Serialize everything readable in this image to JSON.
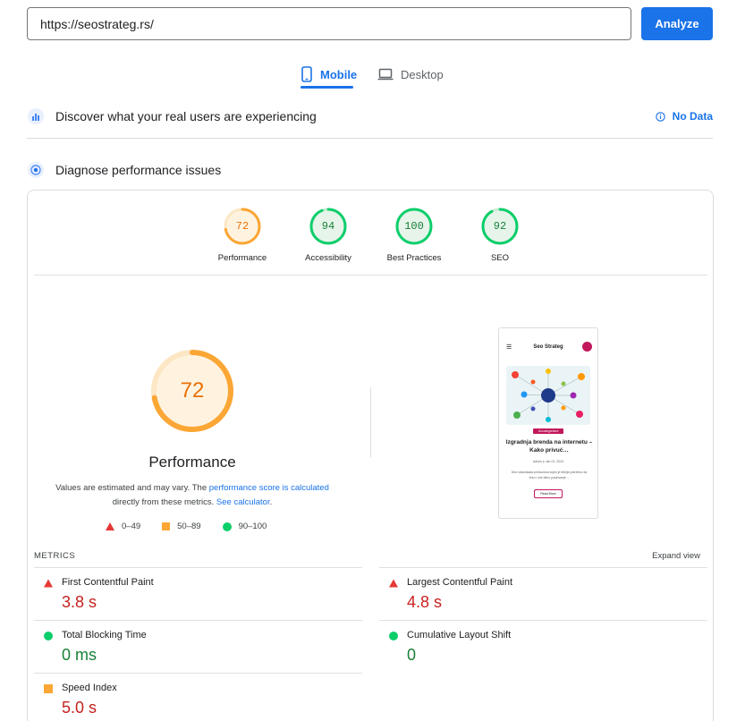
{
  "search": {
    "url": "https://seostrateg.rs/",
    "button_label": "Analyze"
  },
  "tabs": [
    {
      "label": "Mobile",
      "icon": "smartphone-icon",
      "active": true
    },
    {
      "label": "Desktop",
      "icon": "laptop-icon",
      "active": false
    }
  ],
  "field_data": {
    "title": "Discover what your real users are experiencing",
    "status_label": "No Data",
    "status_icon": "info-icon"
  },
  "lab_data": {
    "title": "Diagnose performance issues"
  },
  "category_scores": [
    {
      "label": "Performance",
      "score": 72,
      "color": "#e8710a",
      "ring": "#fba635",
      "fill": "#fff3e0"
    },
    {
      "label": "Accessibility",
      "score": 94,
      "color": "#188038",
      "ring": "#0cce6b",
      "fill": "#e6f4ea"
    },
    {
      "label": "Best Practices",
      "score": 100,
      "color": "#188038",
      "ring": "#0cce6b",
      "fill": "#e6f4ea"
    },
    {
      "label": "SEO",
      "score": 92,
      "color": "#188038",
      "ring": "#0cce6b",
      "fill": "#e6f4ea"
    }
  ],
  "performance_summary": {
    "score": 72,
    "title": "Performance",
    "desc_part1": "Values are estimated and may vary. The ",
    "desc_link1": "performance score is calculated",
    "desc_part2": "directly from these metrics. ",
    "desc_link2": "See calculator",
    "desc_end": "."
  },
  "legend": [
    {
      "range": "0–49",
      "shape": "triangle",
      "color": "#e53935"
    },
    {
      "range": "50–89",
      "shape": "square",
      "color": "#fba635"
    },
    {
      "range": "90–100",
      "shape": "circle",
      "color": "#0cce6b"
    }
  ],
  "screenshot": {
    "brand": "Seo Strateg",
    "tag": "Uncategorized",
    "headline": "Izgradnja brenda na internetu – Kako privuć…",
    "meta": "Admin  ●  Jan 01, 2024",
    "excerpt": "Deci vlasnikada preduzeća kojim je bitnije potrebno da brzo i sve bitno poslovanje…",
    "button": "Read More"
  },
  "metrics": {
    "section_label": "METRICS",
    "expand_label": "Expand view",
    "items": [
      {
        "name": "First Contentful Paint",
        "value": "3.8 s",
        "rating": "poor",
        "color": "#c5221f"
      },
      {
        "name": "Largest Contentful Paint",
        "value": "4.8 s",
        "rating": "poor",
        "color": "#c5221f"
      },
      {
        "name": "Total Blocking Time",
        "value": "0 ms",
        "rating": "good",
        "color": "#188038"
      },
      {
        "name": "Cumulative Layout Shift",
        "value": "0",
        "rating": "good",
        "color": "#188038"
      },
      {
        "name": "Speed Index",
        "value": "5.0 s",
        "rating": "poor",
        "color": "#c5221f"
      }
    ]
  }
}
